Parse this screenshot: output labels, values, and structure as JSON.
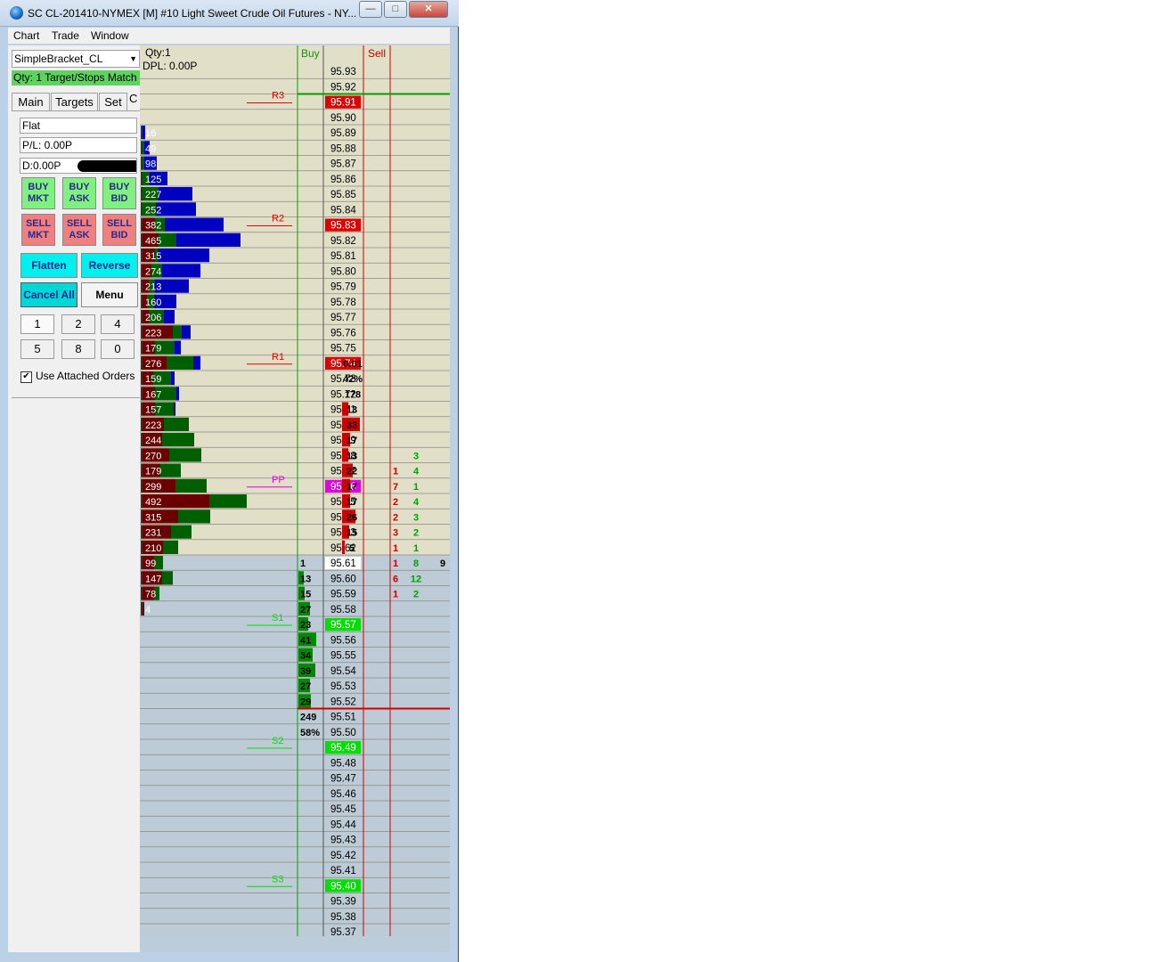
{
  "window": {
    "title": "SC CL-201410-NYMEX [M]  #10  Light Sweet Crude Oil Futures - NY...",
    "minimize_glyph": "—",
    "maximize_glyph": "□",
    "close_glyph": "✕"
  },
  "menu": {
    "chart": "Chart",
    "trade": "Trade",
    "window": "Window"
  },
  "panel": {
    "strategy_value": "SimpleBracket_CL",
    "status_text": "Qty: 1 Target/Stops Match",
    "tabs": [
      "Main",
      "Targets",
      "Set",
      "C"
    ],
    "position": "Flat",
    "pl": "P/L: 0.00P",
    "daily": "D:0.00P",
    "buy_buttons": [
      [
        "BUY",
        "MKT"
      ],
      [
        "BUY",
        "ASK"
      ],
      [
        "BUY",
        "BID"
      ]
    ],
    "sell_buttons": [
      [
        "SELL",
        "MKT"
      ],
      [
        "SELL",
        "ASK"
      ],
      [
        "SELL",
        "BID"
      ]
    ],
    "flatten": "Flatten",
    "reverse": "Reverse",
    "cancel_all": "Cancel All",
    "menu_button": "Menu",
    "qty_buttons": [
      "1",
      "2",
      "4",
      "5",
      "8",
      "0"
    ],
    "use_attached_label": "Use Attached Orders",
    "use_attached_checked": true
  },
  "ladder": {
    "qty_label": "Qty:1",
    "dpl_label": "DPL: 0.00P",
    "buy_header": "Buy",
    "sell_header": "Sell",
    "colors": {
      "upper_bg": "#e2dfc8",
      "lower_bg": "#bccbd6",
      "ask_bar": "#cc0000",
      "bid_bar": "#008800",
      "vp_sell": "#6b0000",
      "vp_buy": "#005f00",
      "vp_blue": "#0000c0",
      "level_red": "#e00000",
      "level_green": "#00e000",
      "level_magenta": "#e000e0",
      "buy_line": "#00a000",
      "sell_line": "#d00000"
    },
    "rows": [
      {
        "p": "95.93"
      },
      {
        "p": "95.92"
      },
      {
        "p": "95.91",
        "hl": "red"
      },
      {
        "p": "95.90"
      },
      {
        "p": "95.89",
        "vt": "16",
        "vs": 0,
        "vb": 0,
        "vbl": 3
      },
      {
        "p": "95.88",
        "vt": "49",
        "vs": 0,
        "vb": 2,
        "vbl": 6
      },
      {
        "p": "95.87",
        "vt": "98",
        "vs": 0,
        "vb": 2,
        "vbl": 14
      },
      {
        "p": "95.86",
        "vt": "125",
        "vs": 0,
        "vb": 8,
        "vbl": 20
      },
      {
        "p": "95.85",
        "vt": "227",
        "vs": 0,
        "vb": 18,
        "vbl": 38
      },
      {
        "p": "95.84",
        "vt": "252",
        "vs": 0,
        "vb": 15,
        "vbl": 45
      },
      {
        "p": "95.83",
        "vt": "382",
        "hl": "red",
        "vs": 14,
        "vb": 11,
        "vbl": 66
      },
      {
        "p": "95.82",
        "vt": "465",
        "vs": 18,
        "vb": 20,
        "vbl": 72
      },
      {
        "p": "95.81",
        "vt": "315",
        "vs": 14,
        "vb": 3,
        "vbl": 58
      },
      {
        "p": "95.80",
        "vt": "274",
        "vs": 10,
        "vb": 12,
        "vbl": 43
      },
      {
        "p": "95.79",
        "vt": "213",
        "vs": 7,
        "vb": 7,
        "vbl": 38
      },
      {
        "p": "95.78",
        "vt": "160",
        "vs": 5,
        "vb": 8,
        "vbl": 25
      },
      {
        "p": "95.77",
        "vt": "206",
        "vs": 7,
        "vb": 17,
        "vbl": 12
      },
      {
        "p": "95.76",
        "vt": "223",
        "vs": 34,
        "vb": 10,
        "vbl": 10
      },
      {
        "p": "95.75",
        "vt": "179",
        "vs": 14,
        "vb": 22,
        "vbl": 7
      },
      {
        "p": "95.74",
        "vt": "276",
        "hl": "red",
        "sell": "0.01",
        "vs": 27,
        "vb": 30,
        "vbl": 8
      },
      {
        "p": "95.73",
        "vt": "159",
        "sell": "42%",
        "vs": 12,
        "vb": 20,
        "vbl": 4
      },
      {
        "p": "95.72",
        "vt": "167",
        "sell": "178",
        "vs": 14,
        "vb": 24,
        "vbl": 3
      },
      {
        "p": "95.71",
        "vt": "157",
        "ask": "13",
        "askw": 7,
        "vs": 14,
        "vb": 21,
        "vbl": 2
      },
      {
        "p": "95.70",
        "vt": "223",
        "ask": "33",
        "askw": 20,
        "vs": 24,
        "vb": 28,
        "vbl": 0
      },
      {
        "p": "95.69",
        "vt": "244",
        "ask": "17",
        "askw": 9,
        "vs": 22,
        "vb": 36,
        "vbl": 0
      },
      {
        "p": "95.68",
        "vt": "270",
        "ask": "13",
        "askw": 7,
        "vs": 30,
        "vb": 36,
        "vbl": 0,
        "tb": "3"
      },
      {
        "p": "95.67",
        "vt": "179",
        "ask": "22",
        "askw": 12,
        "vs": 20,
        "vb": 23,
        "vbl": 0,
        "ts": "1",
        "tb": "4"
      },
      {
        "p": "95.66",
        "vt": "299",
        "hl": "magenta",
        "ask": "17",
        "askw": 9,
        "vs": 37,
        "vb": 35,
        "vbl": 0,
        "ts": "7",
        "tb": "1"
      },
      {
        "p": "95.65",
        "vt": "492",
        "ask": "17",
        "askw": 9,
        "vs": 75,
        "vb": 42,
        "vbl": 0,
        "ts": "2",
        "tb": "4"
      },
      {
        "p": "95.64",
        "vt": "315",
        "ask": "26",
        "askw": 15,
        "vs": 40,
        "vb": 36,
        "vbl": 0,
        "ts": "2",
        "tb": "3"
      },
      {
        "p": "95.63",
        "vt": "231",
        "ask": "15",
        "askw": 8,
        "vs": 32,
        "vb": 23,
        "vbl": 0,
        "ts": "3",
        "tb": "2"
      },
      {
        "p": "95.62",
        "vt": "210",
        "ask": "5",
        "askw": 3,
        "vs": 23,
        "vb": 17,
        "vbl": 0,
        "ts": "1",
        "tb": "1"
      },
      {
        "p": "95.61",
        "vt": "99",
        "hl": "white",
        "bid": "1",
        "bidw": 0,
        "vs": 13,
        "vb": 10,
        "vbl": 0,
        "ts": "1",
        "tb": "8",
        "tx": "9"
      },
      {
        "p": "95.60",
        "vt": "147",
        "bid": "13",
        "bidw": 6,
        "vs": 22,
        "vb": 12,
        "vbl": 0,
        "ts": "6",
        "tb": "12"
      },
      {
        "p": "95.59",
        "vt": "78",
        "bid": "15",
        "bidw": 7,
        "vs": 13,
        "vb": 6,
        "vbl": 0,
        "ts": "1",
        "tb": "2"
      },
      {
        "p": "95.58",
        "vt": "4",
        "bid": "27",
        "bidw": 13,
        "vs": 2,
        "vb": 0,
        "vbl": 0
      },
      {
        "p": "95.57",
        "hl": "green",
        "bid": "23",
        "bidw": 11
      },
      {
        "p": "95.56",
        "bid": "41",
        "bidw": 20
      },
      {
        "p": "95.55",
        "bid": "34",
        "bidw": 16
      },
      {
        "p": "95.54",
        "bid": "39",
        "bidw": 19
      },
      {
        "p": "95.53",
        "bid": "27",
        "bidw": 13
      },
      {
        "p": "95.52",
        "bid": "29",
        "bidw": 14
      },
      {
        "p": "95.51",
        "buy": "249"
      },
      {
        "p": "95.50",
        "buy": "58%"
      },
      {
        "p": "95.49",
        "hl": "green"
      },
      {
        "p": "95.48"
      },
      {
        "p": "95.47"
      },
      {
        "p": "95.46"
      },
      {
        "p": "95.45"
      },
      {
        "p": "95.44"
      },
      {
        "p": "95.43"
      },
      {
        "p": "95.42"
      },
      {
        "p": "95.41"
      },
      {
        "p": "95.40",
        "hl": "green"
      },
      {
        "p": "95.39"
      },
      {
        "p": "95.38"
      },
      {
        "p": "95.37"
      }
    ],
    "levels": [
      {
        "label": "R3",
        "price": "95.91",
        "color": "red"
      },
      {
        "label": "R2",
        "price": "95.83",
        "color": "red"
      },
      {
        "label": "R1",
        "price": "95.74",
        "color": "red"
      },
      {
        "label": "PP",
        "price": "95.66",
        "color": "magenta"
      },
      {
        "label": "S1",
        "price": "95.57",
        "color": "green"
      },
      {
        "label": "S2",
        "price": "95.49",
        "color": "green"
      },
      {
        "label": "S3",
        "price": "95.40",
        "color": "green"
      }
    ],
    "last_trade_price": "95.61",
    "green_line_below": "95.93",
    "red_line_below": "95.52"
  }
}
